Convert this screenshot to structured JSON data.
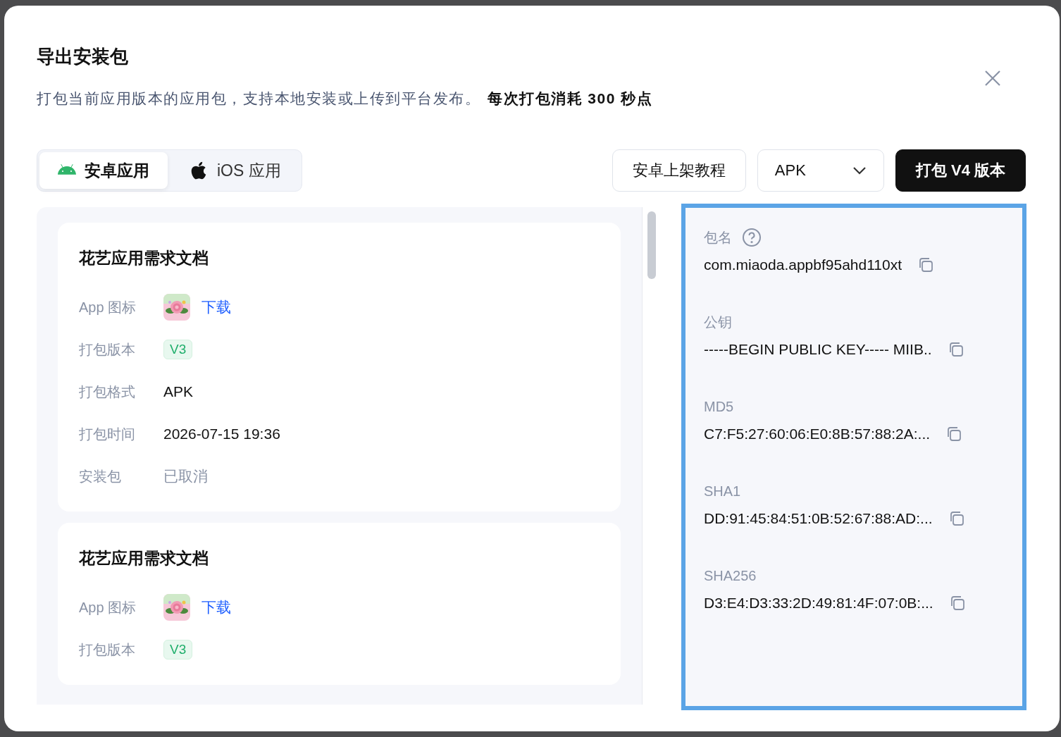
{
  "dialog": {
    "title": "导出安装包",
    "description": {
      "text": "打包当前应用版本的应用包，支持本地安装或上传到平台发布。",
      "emphasis": "每次打包消耗 300 秒点"
    }
  },
  "tabs": [
    {
      "label": "安卓应用",
      "kind": "android",
      "selected": true
    },
    {
      "label": "iOS 应用",
      "kind": "ios",
      "selected": false
    }
  ],
  "toolbar": {
    "guide_button": "安卓上架教程",
    "format_select": {
      "value": "APK"
    },
    "build_button": "打包 V4 版本"
  },
  "builds": [
    {
      "title": "花艺应用需求文档",
      "rows": [
        {
          "kind": "icon",
          "label": "App 图标",
          "link": "下载"
        },
        {
          "kind": "tag",
          "label": "打包版本",
          "value": "V3"
        },
        {
          "kind": "text",
          "label": "打包格式",
          "value": "APK"
        },
        {
          "kind": "text",
          "label": "打包时间",
          "value": "2026-07-15 19:36"
        },
        {
          "kind": "muted",
          "label": "安装包",
          "value": "已取消"
        }
      ]
    },
    {
      "title": "花艺应用需求文档",
      "rows": [
        {
          "kind": "icon",
          "label": "App 图标",
          "link": "下载"
        },
        {
          "kind": "tag",
          "label": "打包版本",
          "value": "V3"
        }
      ]
    }
  ],
  "package_info": [
    {
      "label": "包名",
      "help": true,
      "value": "com.miaoda.appbf95ahd110xt"
    },
    {
      "label": "公钥",
      "help": false,
      "value": "-----BEGIN PUBLIC KEY----- MIIB.."
    },
    {
      "label": "MD5",
      "help": false,
      "value": "C7:F5:27:60:06:E0:8B:57:88:2A:..."
    },
    {
      "label": "SHA1",
      "help": false,
      "value": "DD:91:45:84:51:0B:52:67:88:AD:..."
    },
    {
      "label": "SHA256",
      "help": false,
      "value": "D3:E4:D3:33:2D:49:81:4F:07:0B:..."
    }
  ]
}
